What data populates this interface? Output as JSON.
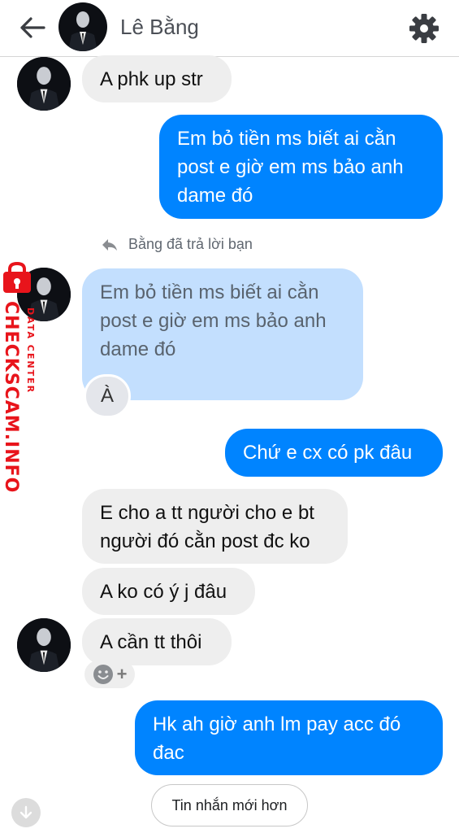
{
  "header": {
    "contact_name": "Lê Bằng",
    "back_icon": "arrow-left-icon",
    "settings_icon": "gear-icon"
  },
  "colors": {
    "outgoing_bubble": "#0084ff",
    "incoming_bubble": "#eeeeee",
    "quoted_bubble": "#c3dffe",
    "watermark": "#e8141b"
  },
  "messages": [
    {
      "direction": "in",
      "text": "A phk up str"
    },
    {
      "direction": "out",
      "text": "Em bỏ tiền ms biết ai cằn post e giờ em ms bảo anh dame đó"
    },
    {
      "direction": "in",
      "reply_note": "Bằng đã trả lời bạn",
      "quoted_text": "Em bỏ tiền ms biết ai cằn post e giờ em ms bảo anh dame đó",
      "text": "À"
    },
    {
      "direction": "out",
      "text": "Chứ e cx có pk đâu"
    },
    {
      "direction": "in",
      "text": "E cho a tt người cho e bt người đó cằn post đc ko"
    },
    {
      "direction": "in",
      "text": "A ko có ý j đâu"
    },
    {
      "direction": "in",
      "text": "A cần tt thôi"
    },
    {
      "direction": "out",
      "text": "Hk ah giờ anh lm pay acc đó đac"
    }
  ],
  "reaction_add": {
    "icon": "smiley-icon",
    "plus": "+"
  },
  "newer_messages_button": "Tin nhắn mới hơn",
  "scroll_down_icon": "arrow-down-icon",
  "watermark": {
    "main": "CHECKSCAM.INFO",
    "sub": "DATA CENTER",
    "icon": "lock-icon"
  }
}
